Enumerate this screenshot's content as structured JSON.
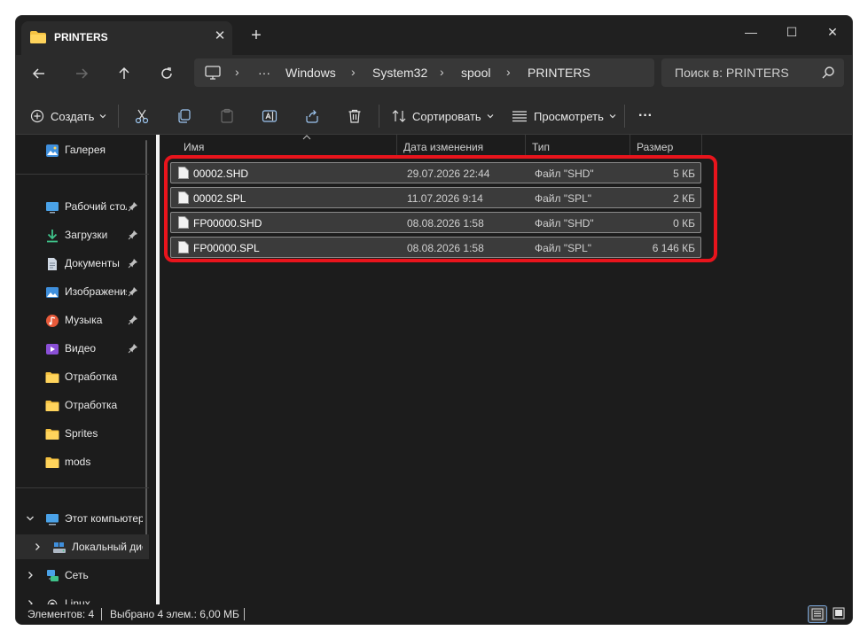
{
  "window": {
    "tab_title": "PRINTERS",
    "tab_close": "✕",
    "new_tab": "+",
    "minimize": "—",
    "maximize": "☐",
    "close": "✕"
  },
  "address": {
    "more": "···",
    "crumbs": [
      "Windows",
      "System32",
      "spool",
      "PRINTERS"
    ],
    "search_placeholder": "Поиск в: PRINTERS"
  },
  "toolbar": {
    "create_label": "Создать",
    "sort_label": "Сортировать",
    "view_label": "Просмотреть",
    "more_label": "···"
  },
  "sidebar": {
    "items": [
      {
        "label": "Галерея",
        "icon": "gallery-icon"
      },
      {
        "label": "Рабочий стол",
        "icon": "desktop-icon",
        "pinned": true
      },
      {
        "label": "Загрузки",
        "icon": "download-icon",
        "pinned": true
      },
      {
        "label": "Документы",
        "icon": "documents-icon",
        "pinned": true
      },
      {
        "label": "Изображения",
        "icon": "pictures-icon",
        "pinned": true
      },
      {
        "label": "Музыка",
        "icon": "music-icon",
        "pinned": true
      },
      {
        "label": "Видео",
        "icon": "video-icon",
        "pinned": true
      },
      {
        "label": "Отработка",
        "icon": "folder-icon"
      },
      {
        "label": "Отработка",
        "icon": "folder-icon"
      },
      {
        "label": "Sprites",
        "icon": "folder-icon"
      },
      {
        "label": "mods",
        "icon": "folder-icon"
      },
      {
        "label": "Этот компьютер",
        "icon": "computer-icon"
      },
      {
        "label": "Локальный диск",
        "icon": "drive-icon"
      },
      {
        "label": "Сеть",
        "icon": "network-icon"
      },
      {
        "label": "Linux",
        "icon": "linux-icon"
      }
    ]
  },
  "columns": {
    "name": "Имя",
    "date": "Дата изменения",
    "type": "Тип",
    "size": "Размер"
  },
  "files": [
    {
      "name": "00002.SHD",
      "date": "29.07.2026 22:44",
      "type": "Файл \"SHD\"",
      "size": "5 КБ"
    },
    {
      "name": "00002.SPL",
      "date": "11.07.2026 9:14",
      "type": "Файл \"SPL\"",
      "size": "2 КБ"
    },
    {
      "name": "FP00000.SHD",
      "date": "08.08.2026 1:58",
      "type": "Файл \"SHD\"",
      "size": "0 КБ"
    },
    {
      "name": "FP00000.SPL",
      "date": "08.08.2026 1:58",
      "type": "Файл \"SPL\"",
      "size": "6 146 КБ"
    }
  ],
  "status": {
    "count": "Элементов: 4",
    "selected": "Выбрано 4 элем.: 6,00 МБ"
  },
  "colors": {
    "highlight": "#e8141c",
    "folder": "#f5c242"
  }
}
